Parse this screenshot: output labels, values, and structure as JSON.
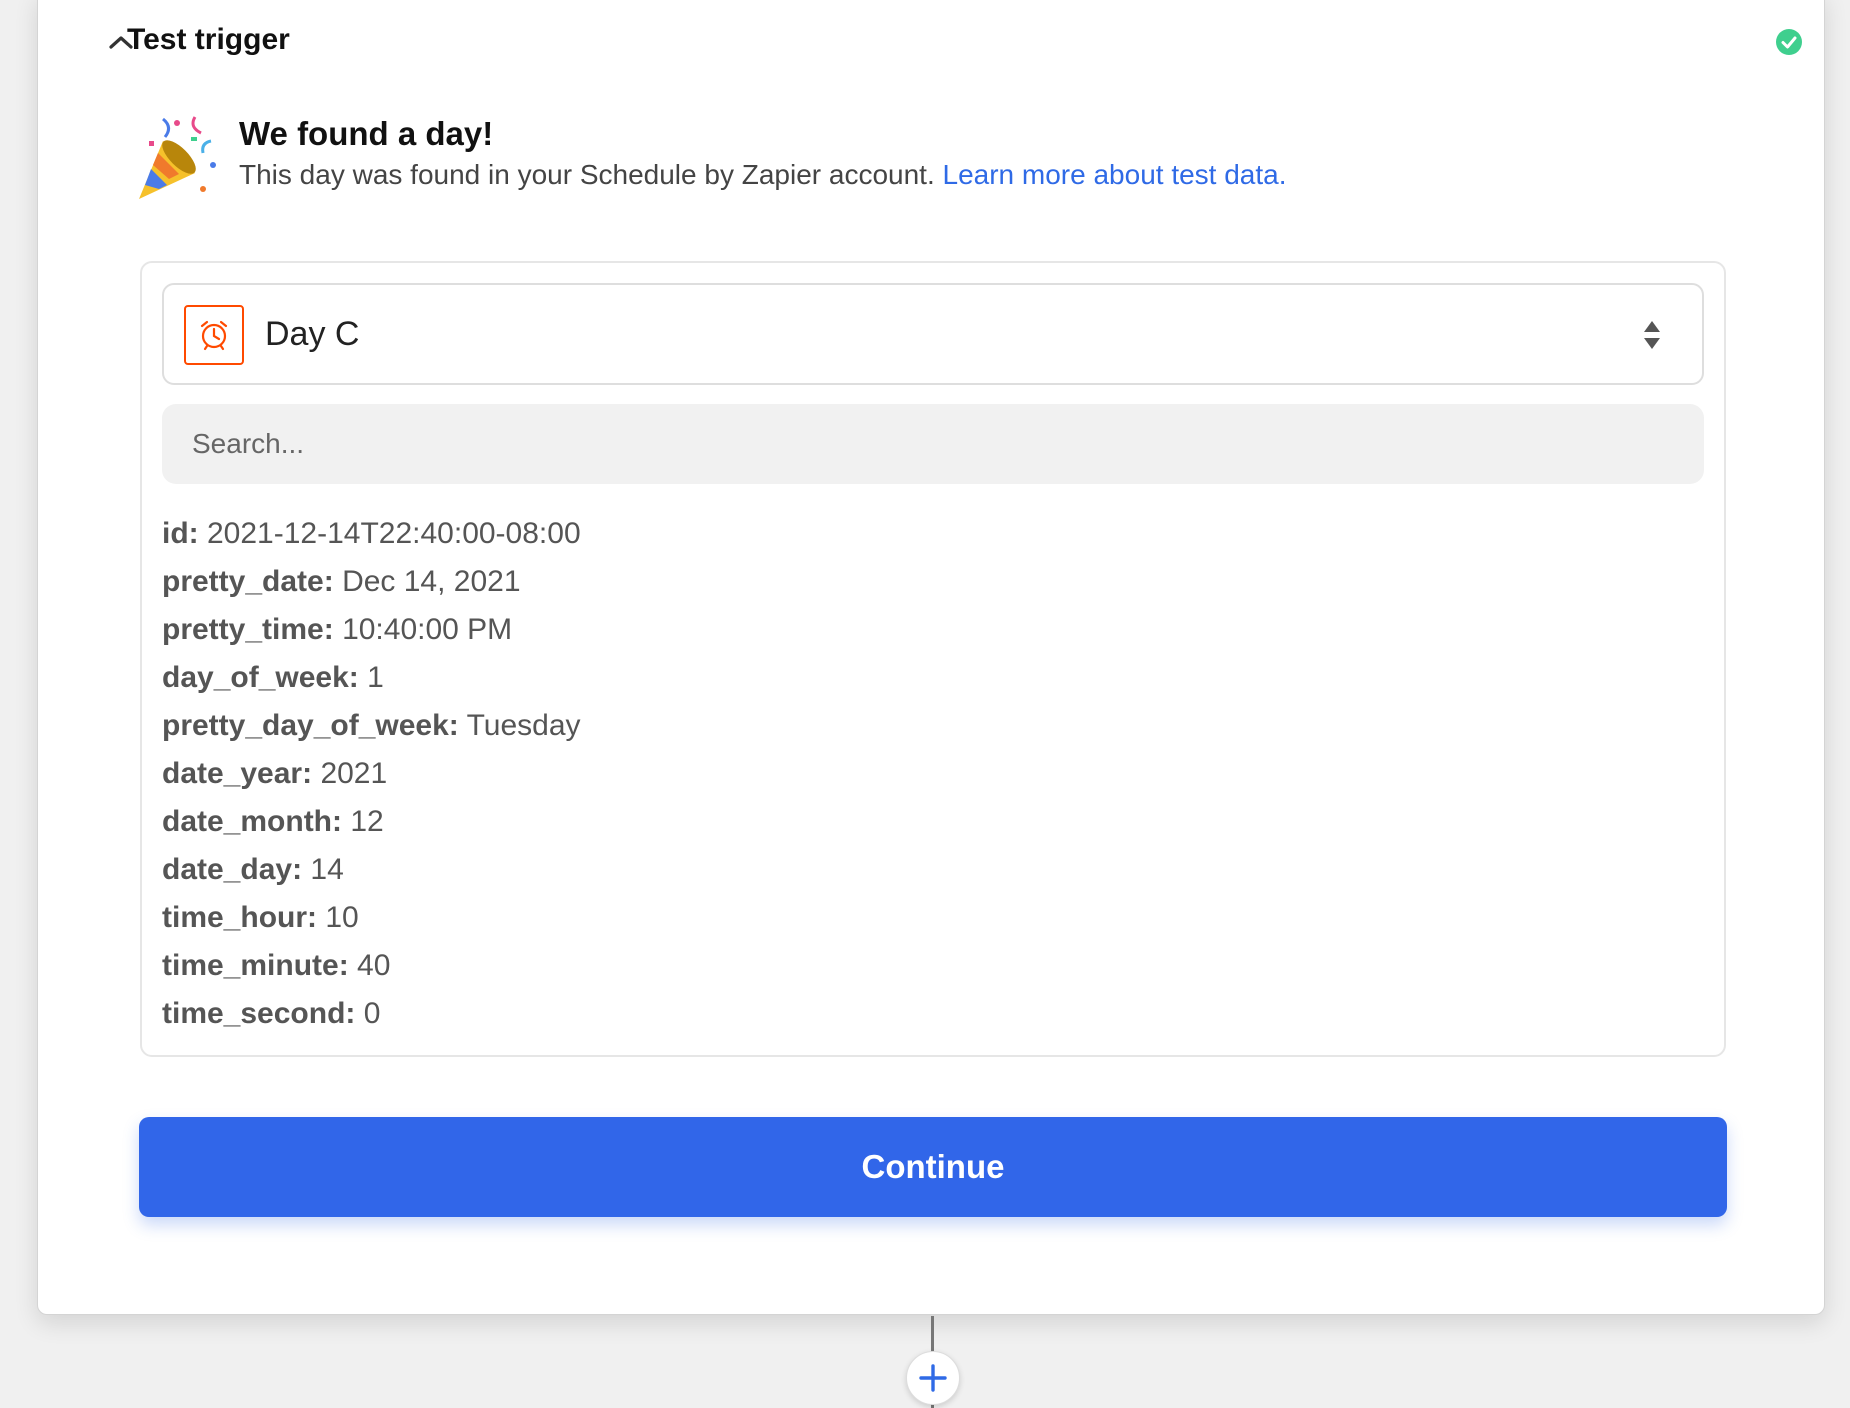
{
  "header": {
    "title": "Test trigger",
    "collapse_icon": "chevron-up-icon",
    "status_icon": "check-circle-icon",
    "status_color": "#3fcf8e"
  },
  "success": {
    "icon": "party-popper-icon",
    "title": "We found a day!",
    "description": "This day was found in your Schedule by Zapier account.",
    "link_text": "Learn more about test data."
  },
  "record_select": {
    "app_icon": "alarm-clock-icon",
    "value": "Day C",
    "icon": "sort-arrows-icon",
    "accent": "#ff4a00"
  },
  "search": {
    "placeholder": "Search..."
  },
  "fields": [
    {
      "key": "id:",
      "value": "2021-12-14T22:40:00-08:00"
    },
    {
      "key": "pretty_date:",
      "value": "Dec 14, 2021"
    },
    {
      "key": "pretty_time:",
      "value": "10:40:00 PM"
    },
    {
      "key": "day_of_week:",
      "value": "1"
    },
    {
      "key": "pretty_day_of_week:",
      "value": "Tuesday"
    },
    {
      "key": "date_year:",
      "value": "2021"
    },
    {
      "key": "date_month:",
      "value": "12"
    },
    {
      "key": "date_day:",
      "value": "14"
    },
    {
      "key": "time_hour:",
      "value": "10"
    },
    {
      "key": "time_minute:",
      "value": "40"
    },
    {
      "key": "time_second:",
      "value": "0"
    }
  ],
  "continue_button": {
    "label": "Continue",
    "color": "#3166e9"
  },
  "add_step": {
    "icon": "plus-icon"
  }
}
